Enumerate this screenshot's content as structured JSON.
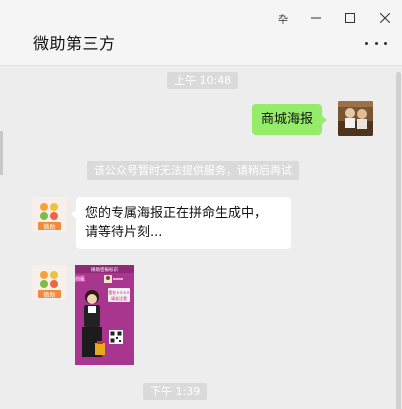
{
  "window": {
    "title": "微助第三方",
    "pin_glyph": "卆",
    "controls": [
      "minimize-icon",
      "maximize-icon",
      "close-icon"
    ]
  },
  "chat": {
    "timestamps": [
      "上午 10:48",
      "下午 1:39"
    ],
    "outgoing": {
      "text": "商城海报"
    },
    "system_notice": "该公众号暂时无法提供服务，请稍后再试",
    "incoming": {
      "lines": [
        "您的专属海报正在拼命生成中，",
        "请等待片刻..."
      ]
    },
    "poster": {
      "header": "微助密报标识",
      "badge": "约我",
      "caption_line1": "我在××××",
      "caption_line2": "请关注我"
    },
    "bot_logo_text": "微助"
  },
  "colors": {
    "outgoing_bubble": "#95ec69",
    "incoming_bubble": "#ffffff",
    "background": "#ededed",
    "poster_bg": "#a8368e"
  }
}
